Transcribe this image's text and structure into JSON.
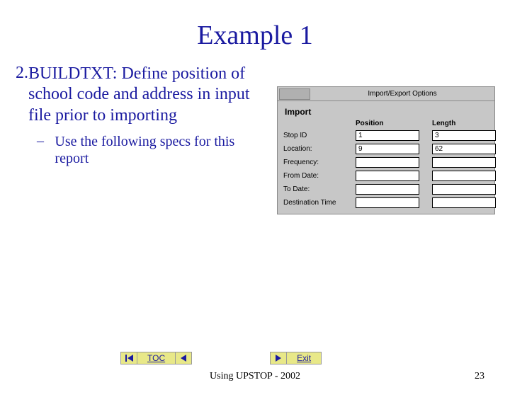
{
  "title": "Example 1",
  "list": {
    "number": "2.",
    "text": "BUILDTXT:  Define position of school code and address in input file prior to importing",
    "sub_bullet": "–",
    "sub_text": "Use the following specs for this report"
  },
  "dialog": {
    "title": "Import/Export Options",
    "subtitle": "Import",
    "headers": {
      "position": "Position",
      "length": "Length"
    },
    "rows": [
      {
        "label": "Stop ID",
        "position": "1",
        "length": "3"
      },
      {
        "label": "Location:",
        "position": "9",
        "length": "62"
      },
      {
        "label": "Frequency:",
        "position": "",
        "length": ""
      },
      {
        "label": "From Date:",
        "position": "",
        "length": ""
      },
      {
        "label": "To Date:",
        "position": "",
        "length": ""
      },
      {
        "label": "Destination Time",
        "position": "",
        "length": ""
      }
    ]
  },
  "nav": {
    "toc": "TOC",
    "exit": "Exit"
  },
  "footer": {
    "center": "Using UPSTOP - 2002",
    "page": "23"
  }
}
